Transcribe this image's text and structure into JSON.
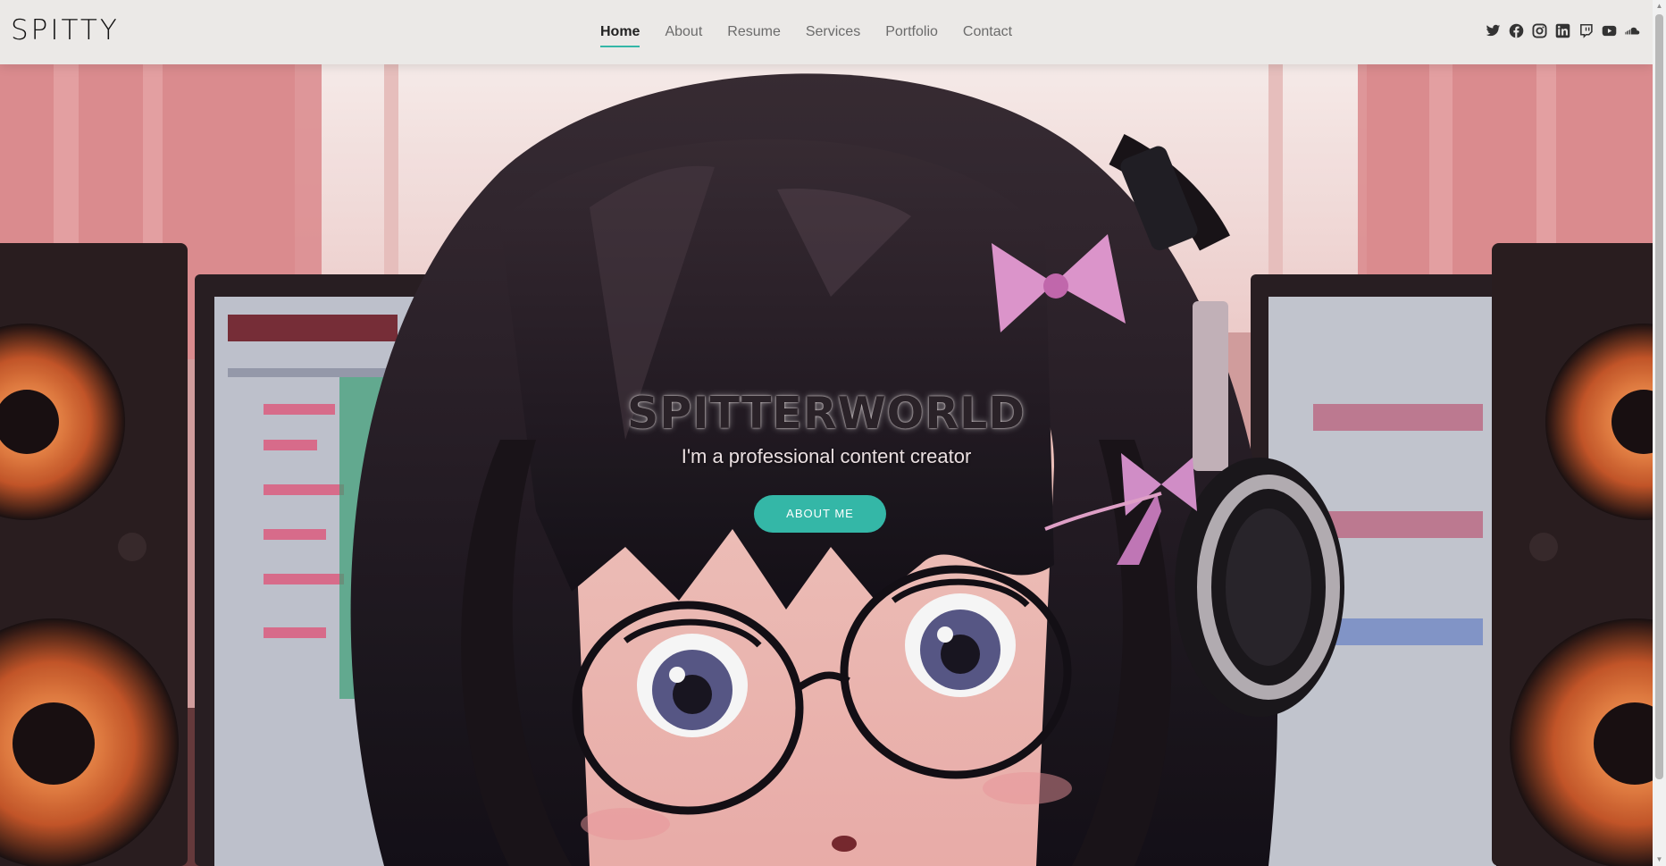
{
  "header": {
    "logo": "SPITTY",
    "nav": [
      {
        "label": "Home",
        "active": true
      },
      {
        "label": "About",
        "active": false
      },
      {
        "label": "Resume",
        "active": false
      },
      {
        "label": "Services",
        "active": false
      },
      {
        "label": "Portfolio",
        "active": false
      },
      {
        "label": "Contact",
        "active": false
      }
    ],
    "social_icons": [
      "twitter-icon",
      "facebook-icon",
      "instagram-icon",
      "linkedin-icon",
      "twitch-icon",
      "youtube-icon",
      "soundcloud-icon"
    ]
  },
  "hero": {
    "title": "SPITTERWORLD",
    "subtitle": "I'm a professional content creator",
    "button_label": "ABOUT ME",
    "background": "anime-girl-headphones-studio-illustration"
  },
  "colors": {
    "accent": "#34b7a7",
    "header_bg": "#ebe9e7",
    "nav_text": "#6b6b6b",
    "nav_active": "#222222"
  }
}
